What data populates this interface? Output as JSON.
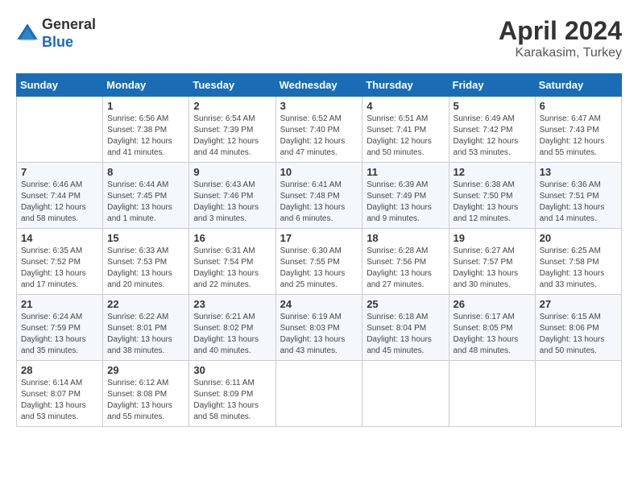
{
  "header": {
    "logo_line1": "General",
    "logo_line2": "Blue",
    "month_year": "April 2024",
    "location": "Karakasim, Turkey"
  },
  "columns": [
    "Sunday",
    "Monday",
    "Tuesday",
    "Wednesday",
    "Thursday",
    "Friday",
    "Saturday"
  ],
  "weeks": [
    [
      {
        "day": "",
        "info": ""
      },
      {
        "day": "1",
        "info": "Sunrise: 6:56 AM\nSunset: 7:38 PM\nDaylight: 12 hours\nand 41 minutes."
      },
      {
        "day": "2",
        "info": "Sunrise: 6:54 AM\nSunset: 7:39 PM\nDaylight: 12 hours\nand 44 minutes."
      },
      {
        "day": "3",
        "info": "Sunrise: 6:52 AM\nSunset: 7:40 PM\nDaylight: 12 hours\nand 47 minutes."
      },
      {
        "day": "4",
        "info": "Sunrise: 6:51 AM\nSunset: 7:41 PM\nDaylight: 12 hours\nand 50 minutes."
      },
      {
        "day": "5",
        "info": "Sunrise: 6:49 AM\nSunset: 7:42 PM\nDaylight: 12 hours\nand 53 minutes."
      },
      {
        "day": "6",
        "info": "Sunrise: 6:47 AM\nSunset: 7:43 PM\nDaylight: 12 hours\nand 55 minutes."
      }
    ],
    [
      {
        "day": "7",
        "info": "Sunrise: 6:46 AM\nSunset: 7:44 PM\nDaylight: 12 hours\nand 58 minutes."
      },
      {
        "day": "8",
        "info": "Sunrise: 6:44 AM\nSunset: 7:45 PM\nDaylight: 13 hours\nand 1 minute."
      },
      {
        "day": "9",
        "info": "Sunrise: 6:43 AM\nSunset: 7:46 PM\nDaylight: 13 hours\nand 3 minutes."
      },
      {
        "day": "10",
        "info": "Sunrise: 6:41 AM\nSunset: 7:48 PM\nDaylight: 13 hours\nand 6 minutes."
      },
      {
        "day": "11",
        "info": "Sunrise: 6:39 AM\nSunset: 7:49 PM\nDaylight: 13 hours\nand 9 minutes."
      },
      {
        "day": "12",
        "info": "Sunrise: 6:38 AM\nSunset: 7:50 PM\nDaylight: 13 hours\nand 12 minutes."
      },
      {
        "day": "13",
        "info": "Sunrise: 6:36 AM\nSunset: 7:51 PM\nDaylight: 13 hours\nand 14 minutes."
      }
    ],
    [
      {
        "day": "14",
        "info": "Sunrise: 6:35 AM\nSunset: 7:52 PM\nDaylight: 13 hours\nand 17 minutes."
      },
      {
        "day": "15",
        "info": "Sunrise: 6:33 AM\nSunset: 7:53 PM\nDaylight: 13 hours\nand 20 minutes."
      },
      {
        "day": "16",
        "info": "Sunrise: 6:31 AM\nSunset: 7:54 PM\nDaylight: 13 hours\nand 22 minutes."
      },
      {
        "day": "17",
        "info": "Sunrise: 6:30 AM\nSunset: 7:55 PM\nDaylight: 13 hours\nand 25 minutes."
      },
      {
        "day": "18",
        "info": "Sunrise: 6:28 AM\nSunset: 7:56 PM\nDaylight: 13 hours\nand 27 minutes."
      },
      {
        "day": "19",
        "info": "Sunrise: 6:27 AM\nSunset: 7:57 PM\nDaylight: 13 hours\nand 30 minutes."
      },
      {
        "day": "20",
        "info": "Sunrise: 6:25 AM\nSunset: 7:58 PM\nDaylight: 13 hours\nand 33 minutes."
      }
    ],
    [
      {
        "day": "21",
        "info": "Sunrise: 6:24 AM\nSunset: 7:59 PM\nDaylight: 13 hours\nand 35 minutes."
      },
      {
        "day": "22",
        "info": "Sunrise: 6:22 AM\nSunset: 8:01 PM\nDaylight: 13 hours\nand 38 minutes."
      },
      {
        "day": "23",
        "info": "Sunrise: 6:21 AM\nSunset: 8:02 PM\nDaylight: 13 hours\nand 40 minutes."
      },
      {
        "day": "24",
        "info": "Sunrise: 6:19 AM\nSunset: 8:03 PM\nDaylight: 13 hours\nand 43 minutes."
      },
      {
        "day": "25",
        "info": "Sunrise: 6:18 AM\nSunset: 8:04 PM\nDaylight: 13 hours\nand 45 minutes."
      },
      {
        "day": "26",
        "info": "Sunrise: 6:17 AM\nSunset: 8:05 PM\nDaylight: 13 hours\nand 48 minutes."
      },
      {
        "day": "27",
        "info": "Sunrise: 6:15 AM\nSunset: 8:06 PM\nDaylight: 13 hours\nand 50 minutes."
      }
    ],
    [
      {
        "day": "28",
        "info": "Sunrise: 6:14 AM\nSunset: 8:07 PM\nDaylight: 13 hours\nand 53 minutes."
      },
      {
        "day": "29",
        "info": "Sunrise: 6:12 AM\nSunset: 8:08 PM\nDaylight: 13 hours\nand 55 minutes."
      },
      {
        "day": "30",
        "info": "Sunrise: 6:11 AM\nSunset: 8:09 PM\nDaylight: 13 hours\nand 58 minutes."
      },
      {
        "day": "",
        "info": ""
      },
      {
        "day": "",
        "info": ""
      },
      {
        "day": "",
        "info": ""
      },
      {
        "day": "",
        "info": ""
      }
    ]
  ]
}
